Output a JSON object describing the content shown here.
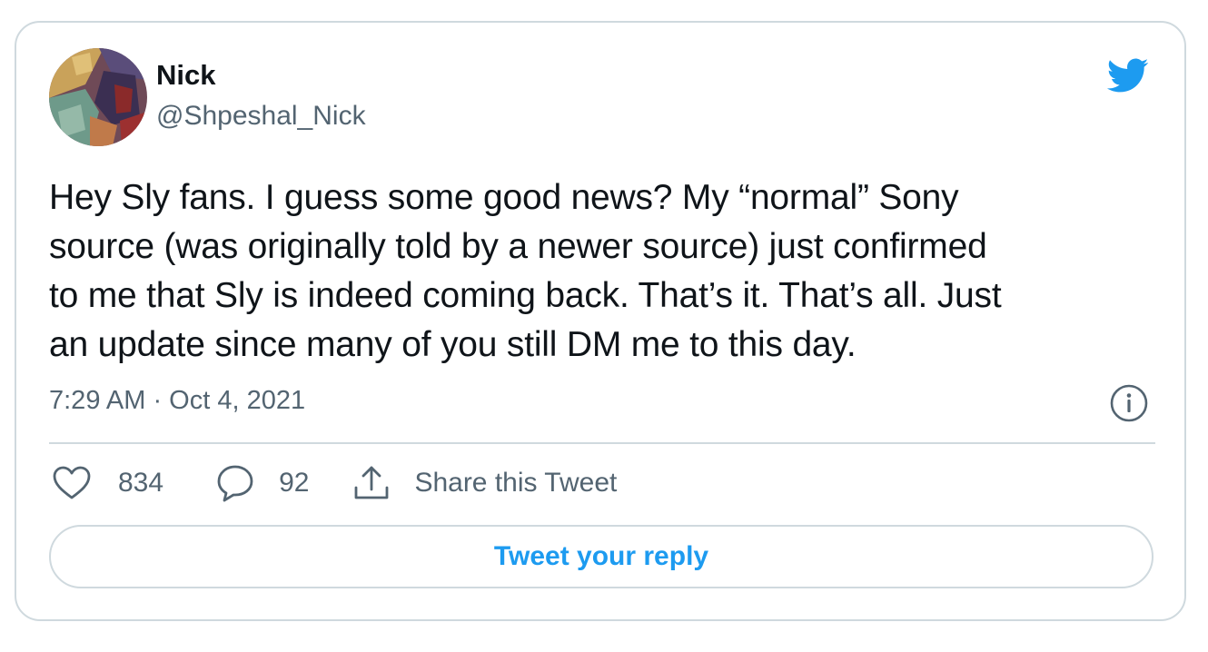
{
  "author": {
    "display_name": "Nick",
    "handle": "@Shpeshal_Nick"
  },
  "tweet": {
    "text": "Hey Sly fans. I guess some good news? My “normal” Sony\nsource (was originally told by a newer source) just confirmed\nto me that Sly is indeed coming back. That’s it. That’s all. Just\nan update since many of you still DM me to this day.",
    "timestamp": "7:29 AM · Oct 4, 2021"
  },
  "actions": {
    "like_count": "834",
    "reply_count": "92",
    "share_label": "Share this Tweet"
  },
  "reply_button_label": "Tweet your reply",
  "icons": {
    "brand": "twitter-bird-icon",
    "info": "info-icon",
    "like": "heart-icon",
    "reply": "speech-bubble-icon",
    "share": "share-upload-icon"
  },
  "colors": {
    "brand": "#1d9bf0",
    "text": "#0f1419",
    "secondary": "#536471",
    "border": "#cfd9de"
  }
}
